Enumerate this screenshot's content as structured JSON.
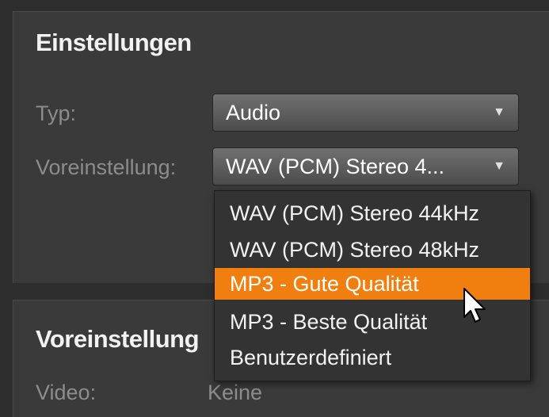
{
  "settings": {
    "title": "Einstellungen",
    "type_label": "Typ:",
    "type_value": "Audio",
    "preset_label": "Voreinstellung:",
    "preset_value": "WAV (PCM) Stereo 4..."
  },
  "dropdown": {
    "options": [
      {
        "label": "WAV (PCM) Stereo 44kHz",
        "selected": false
      },
      {
        "label": "WAV (PCM) Stereo 48kHz",
        "selected": false
      },
      {
        "label": "MP3 - Gute Qualität",
        "selected": true
      },
      {
        "label": "MP3 - Beste Qualität",
        "selected": false
      },
      {
        "label": "Benutzerdefiniert",
        "selected": false
      }
    ]
  },
  "presets": {
    "title": "Voreinstellung",
    "video_label": "Video:",
    "video_value": "Keine"
  },
  "icons": {
    "combo_arrow": "chevron-down-icon",
    "cursor": "mouse-pointer-icon"
  },
  "colors": {
    "highlight": "#f07f10",
    "panel": "#3a3a3a",
    "background": "#2d2d2d"
  }
}
